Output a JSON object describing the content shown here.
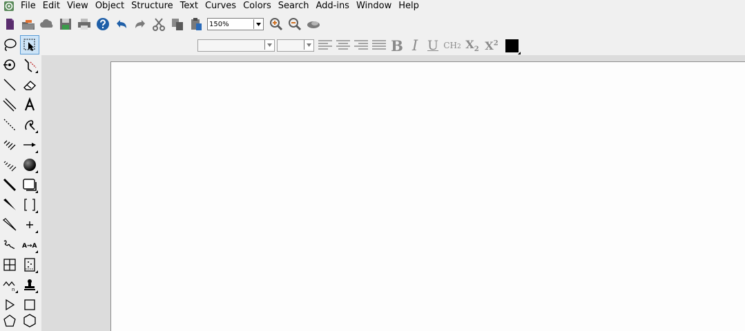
{
  "menu": [
    "File",
    "Edit",
    "View",
    "Object",
    "Structure",
    "Text",
    "Curves",
    "Colors",
    "Search",
    "Add-ins",
    "Window",
    "Help"
  ],
  "toolbar": {
    "zoom_value": "150%",
    "buttons": [
      "new-document-icon",
      "open-icon",
      "cloud-icon",
      "save-icon",
      "print-icon",
      "help-icon",
      "undo-icon",
      "redo-icon",
      "cut-icon",
      "copy-icon",
      "paste-icon"
    ]
  },
  "textbar": {
    "font_name": "",
    "font_size": "",
    "bold": "B",
    "italic": "I",
    "underline": "U",
    "formula": "CH",
    "formula_sub": "2",
    "subscript": "X",
    "subscript_sub": "2",
    "superscript": "X",
    "superscript_sup": "2",
    "color": "#000000"
  },
  "palette_tools": [
    "lasso-icon",
    "select-arrow-icon",
    "rotate-icon",
    "bond-pen-icon",
    "single-bond-icon",
    "eraser-icon",
    "double-bond-icon",
    "text-icon",
    "dashed-bond-icon",
    "pen-icon",
    "hashed-bond-icon",
    "arrow-icon",
    "wedge-hash-icon",
    "orbital-icon",
    "bold-bond-icon",
    "shape-icon",
    "wedge-bond-icon",
    "bracket-icon",
    "hollow-wedge-icon",
    "charge-icon",
    "wavy-bond-icon",
    "reaction-map-icon",
    "table-icon",
    "tlc-plate-icon",
    "chain-icon",
    "stamp-icon",
    "triangle-ring-icon",
    "square-ring-icon",
    "pentagon-ring-icon",
    "hexagon-ring-icon"
  ]
}
